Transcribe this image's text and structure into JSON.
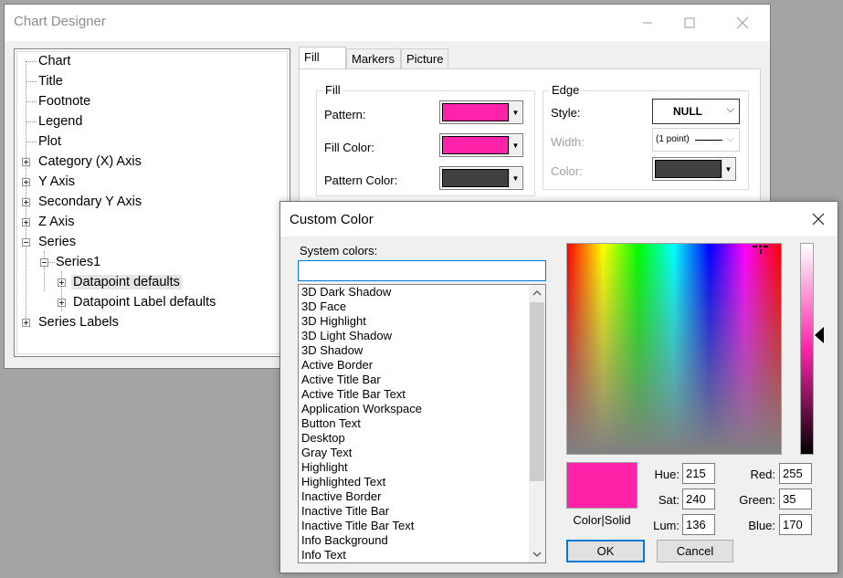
{
  "designer": {
    "title": "Chart Designer",
    "tabs": [
      "Fill",
      "Markers",
      "Picture"
    ],
    "tree": [
      {
        "label": "Chart"
      },
      {
        "label": "Title"
      },
      {
        "label": "Footnote"
      },
      {
        "label": "Legend"
      },
      {
        "label": "Plot"
      },
      {
        "label": "Category (X) Axis"
      },
      {
        "label": "Y Axis"
      },
      {
        "label": "Secondary Y Axis"
      },
      {
        "label": "Z Axis"
      },
      {
        "label": "Series"
      },
      {
        "label": "Series1"
      },
      {
        "label": "Datapoint defaults"
      },
      {
        "label": "Datapoint Label defaults"
      },
      {
        "label": "Series Labels"
      }
    ],
    "fill": {
      "group_title": "Fill",
      "pattern_label": "Pattern:",
      "fill_color_label": "Fill Color:",
      "pattern_color_label": "Pattern Color:",
      "pattern_color": "#ff23aa",
      "fill_color": "#ff23aa",
      "pattern_fg_color": "#404040"
    },
    "edge": {
      "group_title": "Edge",
      "style_label": "Style:",
      "style_value": "NULL",
      "width_label": "Width:",
      "width_value": "(1 point)",
      "color_label": "Color:",
      "color": "#404040"
    }
  },
  "custom_color": {
    "title": "Custom Color",
    "system_colors_label": "System colors:",
    "system_colors_input": "",
    "system_colors": [
      "3D Dark Shadow",
      "3D Face",
      "3D Highlight",
      "3D Light Shadow",
      "3D Shadow",
      "Active Border",
      "Active Title Bar",
      "Active Title Bar Text",
      "Application Workspace",
      "Button Text",
      "Desktop",
      "Gray Text",
      "Highlight",
      "Highlighted Text",
      "Inactive Border",
      "Inactive Title Bar",
      "Inactive Title Bar Text",
      "Info Background",
      "Info Text"
    ],
    "preview_label": "Color|Solid",
    "preview_color": "#ff23aa",
    "hue_label": "Hue:",
    "hue": "215",
    "sat_label": "Sat:",
    "sat": "240",
    "lum_label": "Lum:",
    "lum": "136",
    "red_label": "Red:",
    "red": "255",
    "green_label": "Green:",
    "green": "35",
    "blue_label": "Blue:",
    "blue": "170",
    "ok_label": "OK",
    "cancel_label": "Cancel"
  }
}
